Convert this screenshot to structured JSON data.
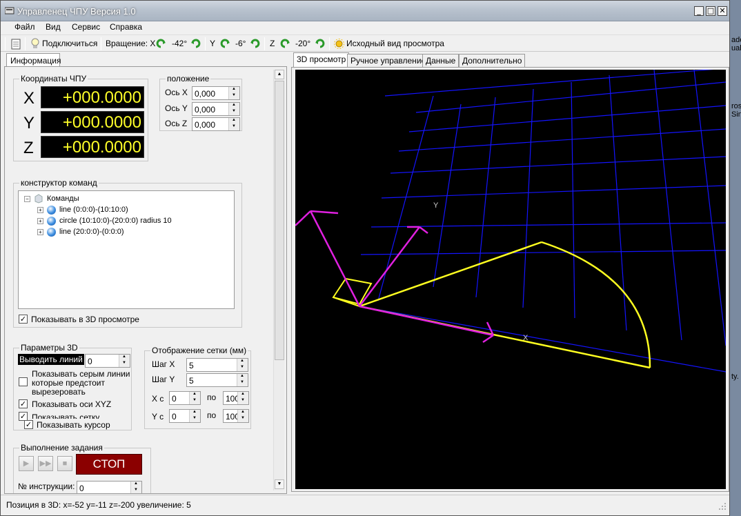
{
  "window": {
    "title": "Управленец ЧПУ Версия 1.0"
  },
  "menu": [
    "Файл",
    "Вид",
    "Сервис",
    "Справка"
  ],
  "toolbar": {
    "connect": "Подключиться",
    "rotation_label": "Вращение: X",
    "rot_x": "-42°",
    "y_label": "Y",
    "rot_y": "-6°",
    "z_label": "Z",
    "rot_z": "-20°",
    "reset_view": "Исходный вид просмотра"
  },
  "left_tab": "Информация",
  "coords": {
    "title": "Координаты ЧПУ",
    "axes": [
      {
        "label": "X",
        "value": "+000.0000"
      },
      {
        "label": "Y",
        "value": "+000.0000"
      },
      {
        "label": "Z",
        "value": "+000.0000"
      }
    ]
  },
  "position": {
    "title": "положение",
    "rows": [
      {
        "label": "Ось X",
        "value": "0,000"
      },
      {
        "label": "Ось Y",
        "value": "0,000"
      },
      {
        "label": "Ось Z",
        "value": "0,000"
      }
    ]
  },
  "constructor": {
    "title": "конструктор команд",
    "root": "Команды",
    "items": [
      "line (0:0:0)-(10:10:0)",
      "circle (10:10:0)-(20:0:0) radius 10",
      "line (20:0:0)-(0:0:0)"
    ],
    "show3d": "Показывать в 3D просмотре"
  },
  "params3d": {
    "title": "Параметры 3D",
    "draw_lines": "Выводить линий",
    "draw_lines_value": "0",
    "gray_lines": [
      "Показывать серым линии",
      "которые предстоит",
      "вырезеровать"
    ],
    "show_axes": "Показывать оси XYZ",
    "show_grid": "Показывать сетку",
    "show_cursor": "Показывать курсор"
  },
  "grid": {
    "title": "Отображение сетки (мм)",
    "step_x_label": "Шаг X",
    "step_x": "5",
    "step_y_label": "Шаг Y",
    "step_y": "5",
    "xc_label": "X с",
    "xc_from": "0",
    "xc_to_label": "по",
    "xc_to": "100",
    "yc_label": "Y с",
    "yc_from": "0",
    "yc_to_label": "по",
    "yc_to": "100"
  },
  "task": {
    "title": "Выполнение задания",
    "stop": "СТОП",
    "instr_label": "№ инструкции:",
    "instr_value": "0"
  },
  "right_tabs": [
    "3D просмотр",
    "Ручное управление",
    "Данные",
    "Дополнительно"
  ],
  "view3d": {
    "axis_x": "X",
    "axis_y": "Y"
  },
  "status": "Позиция в 3D: x=-52 y=-11 z=-200 увеличение: 5",
  "desktop_fragments": [
    "ade",
    "ual",
    "ros",
    "Sin",
    "ty."
  ],
  "colors": {
    "grid": "#1010ff",
    "path": "#ffff20",
    "axes": "#e020e0",
    "stop_bg": "#8b0000",
    "coord_text": "#ffff29"
  }
}
